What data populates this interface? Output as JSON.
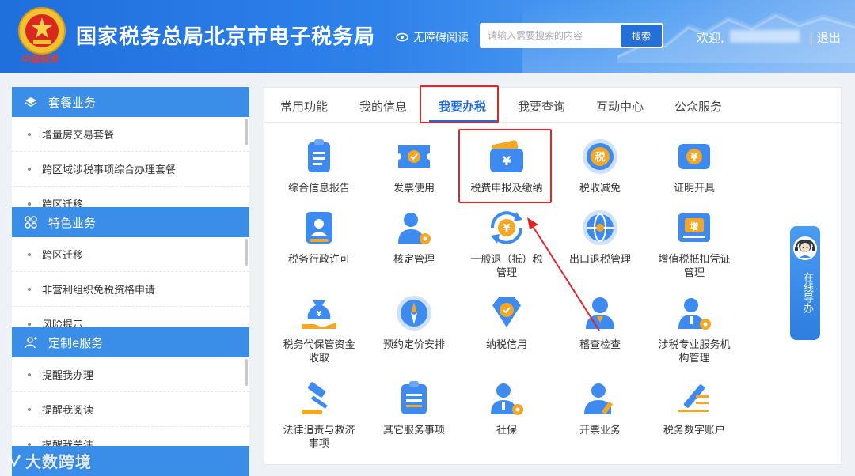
{
  "header": {
    "site_title": "国家税务总局北京市电子税务局",
    "emblem_text": "中国税务",
    "accessibility_label": "无障碍阅读",
    "search_placeholder": "请输入需要搜索的内容",
    "search_button": "搜索",
    "welcome": "欢迎,",
    "logout": "| 退出"
  },
  "sidebar": {
    "sections": [
      {
        "title": "套餐业务",
        "icon": "layers-icon",
        "items": [
          "增量房交易套餐",
          "跨区域涉税事项综合办理套餐",
          "跨区迁移"
        ]
      },
      {
        "title": "特色业务",
        "icon": "grid-icon",
        "items": [
          "跨区迁移",
          "非营利组织免税资格申请",
          "风险提示"
        ]
      },
      {
        "title": "定制e服务",
        "icon": "user-plus-icon",
        "items": [
          "提醒我办理",
          "提醒我阅读",
          "提醒我关注"
        ]
      },
      {
        "title": "",
        "icon": "",
        "items": []
      }
    ]
  },
  "tabs": [
    "常用功能",
    "我的信息",
    "我要办税",
    "我要查询",
    "互动中心",
    "公众服务"
  ],
  "active_tab": "我要办税",
  "grid": [
    {
      "label": "综合信息报告",
      "icon": "clipboard-icon"
    },
    {
      "label": "发票使用",
      "icon": "ticket-check-icon"
    },
    {
      "label": "税费申报及缴纳",
      "icon": "wallet-yuan-icon"
    },
    {
      "label": "税收减免",
      "icon": "tax-badge-icon"
    },
    {
      "label": "证明开具",
      "icon": "yuan-ticket-icon"
    },
    {
      "label": "税务行政许可",
      "icon": "id-card-icon"
    },
    {
      "label": "核定管理",
      "icon": "user-gear-icon"
    },
    {
      "label": "一般退（抵）税管理",
      "icon": "yuan-refresh-icon"
    },
    {
      "label": "出口退税管理",
      "icon": "globe-icon"
    },
    {
      "label": "增值税抵扣凭证管理",
      "icon": "vat-ticket-icon"
    },
    {
      "label": "税务代保管资金收取",
      "icon": "money-bag-hand-icon"
    },
    {
      "label": "预约定价安排",
      "icon": "compass-icon"
    },
    {
      "label": "纳税信用",
      "icon": "diamond-check-icon"
    },
    {
      "label": "稽查检查",
      "icon": "user-icon"
    },
    {
      "label": "涉税专业服务机构管理",
      "icon": "user-tie-gear-icon"
    },
    {
      "label": "法律追责与救济事项",
      "icon": "gavel-icon"
    },
    {
      "label": "其它服务事项",
      "icon": "list-clipboard-icon"
    },
    {
      "label": "社保",
      "icon": "user-shield-icon"
    },
    {
      "label": "开票业务",
      "icon": "user-pen-icon"
    },
    {
      "label": "税务数字账户",
      "icon": "pen-lines-icon"
    }
  ],
  "online_service": "在线导办",
  "watermark": "大数跨境",
  "colors": {
    "primary": "#2468d6",
    "sidebar_head": "#3a8ee8",
    "highlight": "#e0262a",
    "icon_blue": "#3d8af0",
    "icon_orange": "#f5a623"
  }
}
